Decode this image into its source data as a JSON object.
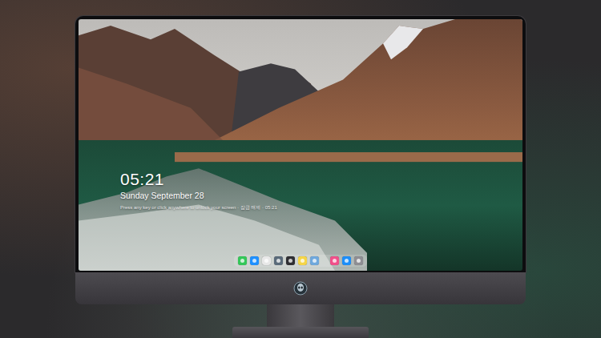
{
  "lock_screen": {
    "time": "05:21",
    "date": "Sunday September 28",
    "hint": "Press any key or click anywhere to unlock your screen · 잠금 해제 · 05:21"
  },
  "dock": {
    "apps": [
      {
        "color": "#34c759"
      },
      {
        "color": "#1e90ff"
      },
      {
        "color": "#e8e8e8"
      },
      {
        "color": "#5a6b7a"
      },
      {
        "color": "#2f2f33"
      },
      {
        "color": "#f5d547"
      },
      {
        "color": "#6fa8dc"
      }
    ],
    "others": [
      {
        "color": "#f0508a"
      },
      {
        "color": "#1c8ef9"
      },
      {
        "color": "#8e8e93"
      }
    ]
  }
}
